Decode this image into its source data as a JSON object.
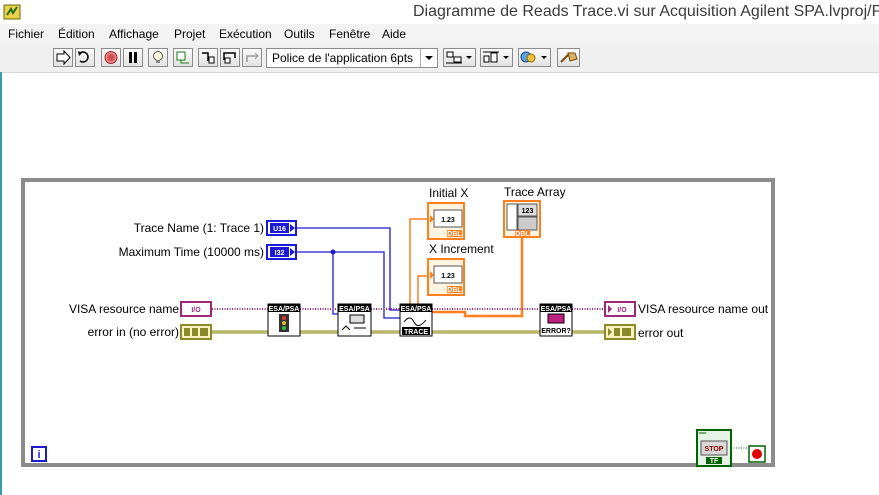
{
  "window": {
    "title": "Diagramme de Reads Trace.vi sur Acquisition Agilent SPA.lvproj/Poste"
  },
  "menu": [
    "Fichier",
    "Édition",
    "Affichage",
    "Projet",
    "Exécution",
    "Outils",
    "Fenêtre",
    "Aide"
  ],
  "toolbar": {
    "font_label": "Police de l'application  6pts"
  },
  "controls": {
    "trace_name": "Trace Name (1: Trace 1)",
    "trace_name_type": "U16",
    "max_time": "Maximum Time (10000 ms)",
    "max_time_type": "I32",
    "visa_in": "VISA resource name",
    "visa_type": "I/O",
    "error_in": "error in (no error)"
  },
  "indicators": {
    "initial_x": "Initial X",
    "x_increment": "X Increment",
    "trace_array": "Trace Array",
    "num_display": "1.23",
    "num_type": "DBL",
    "array_index": "123",
    "visa_out": "VISA resource name out",
    "visa_out_type": "I/O",
    "error_out": "error out"
  },
  "subvis": {
    "header": "ESA/PSA",
    "trace_caption": "TRACE",
    "error_caption": "ERROR?"
  },
  "loop": {
    "stop_label": "STOP",
    "stop_type": "TF",
    "info_glyph": "i"
  },
  "colors": {
    "loop_border": "#8c8c8c",
    "integer_wire": "#1a1ad4",
    "double_wire": "#ff7f1f",
    "visa_wire": "#a0287a",
    "error_wire": "#8a8a2a",
    "boolean_wire": "#006400"
  },
  "icons": [
    "labview-vi-icon",
    "run-arrow-icon",
    "run-continuous-icon",
    "abort-icon",
    "pause-icon",
    "highlight-bulb-icon",
    "retain-wire-icon",
    "step-into-icon",
    "step-over-icon",
    "step-out-icon",
    "align-icon",
    "distribute-icon",
    "reorder-icon",
    "cleanup-icon"
  ]
}
